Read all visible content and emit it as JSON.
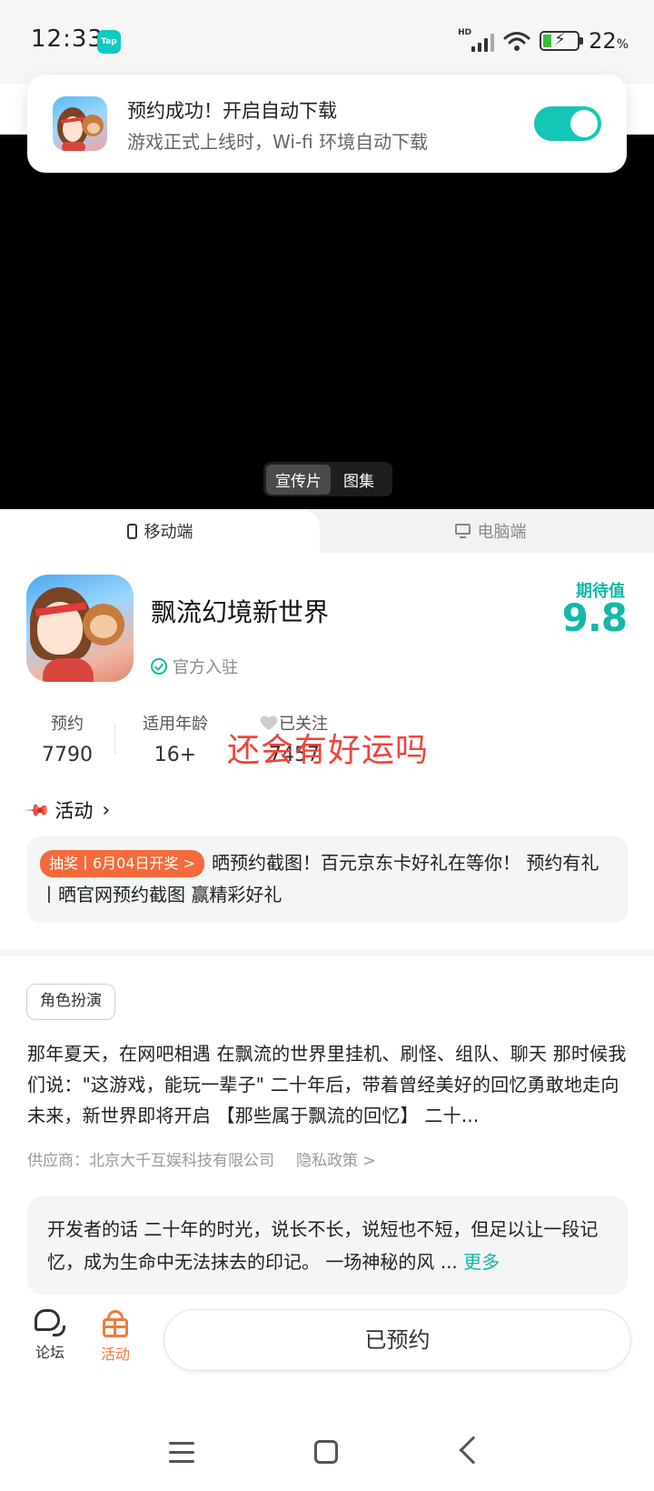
{
  "status_bar": {
    "time": "12:33",
    "app_badge": "Tap",
    "network": "HD",
    "battery_percent": "22",
    "battery_unit": "%"
  },
  "toast": {
    "title": "预约成功！开启自动下载",
    "subtitle": "游戏正式上线时，Wi-fi 环境自动下载",
    "auto_download_enabled": true
  },
  "media_tabs": [
    {
      "label": "宣传片",
      "active": true
    },
    {
      "label": "图集",
      "active": false
    }
  ],
  "platform_tabs": {
    "mobile": "移动端",
    "pc": "电脑端"
  },
  "game": {
    "title": "飘流幻境新世界",
    "verified_label": "官方入驻",
    "expectation_label": "期待值",
    "expectation_score": "9.8"
  },
  "stats": {
    "reservations": {
      "label": "预约",
      "value": "7790"
    },
    "age_rating": {
      "label": "适用年龄",
      "value": "16+"
    },
    "follow": {
      "label": "已关注",
      "value": "7457"
    }
  },
  "overlay_text": "还会有好运吗",
  "activity": {
    "header": "活动",
    "tag": "抽奖丨6月04日开奖 >",
    "text": "晒预约截图！百元京东卡好礼在等你！ 预约有礼丨晒官网预约截图 赢精彩好礼"
  },
  "genre_tag": "角色扮演",
  "description": "那年夏天，在网吧相遇 在飘流的世界里挂机、刷怪、组队、聊天 那时候我们说：\"这游戏，能玩一辈子\" 二十年后，带着曾经美好的回忆勇敢地走向未来，新世界即将开启 【那些属于飘流的回忆】 二十...",
  "supplier": "供应商：北京大千互娱科技有限公司",
  "privacy_link": "隐私政策 >",
  "developer_note": {
    "text": "开发者的话  二十年的时光，说长不长，说短也不短，但足以让一段记忆，成为生命中无法抹去的印记。 一场神秘的风 ...",
    "more": "更多"
  },
  "bottom_nav": {
    "forum": "论坛",
    "activity": "活动",
    "reserved_button": "已预约"
  },
  "colors": {
    "accent": "#13b8a8",
    "lottery_tag": "#f46a3d",
    "activity_nav": "#f07a3c",
    "overlay_text": "#f0443a"
  },
  "icons": [
    "tap-app-icon",
    "signal-icon",
    "wifi-icon",
    "battery-icon",
    "phone-icon",
    "monitor-icon",
    "verified-check-icon",
    "heart-icon",
    "pin-icon",
    "chevron-right-icon",
    "forum-icon",
    "gift-icon",
    "menu-icon",
    "home-icon",
    "back-icon"
  ]
}
